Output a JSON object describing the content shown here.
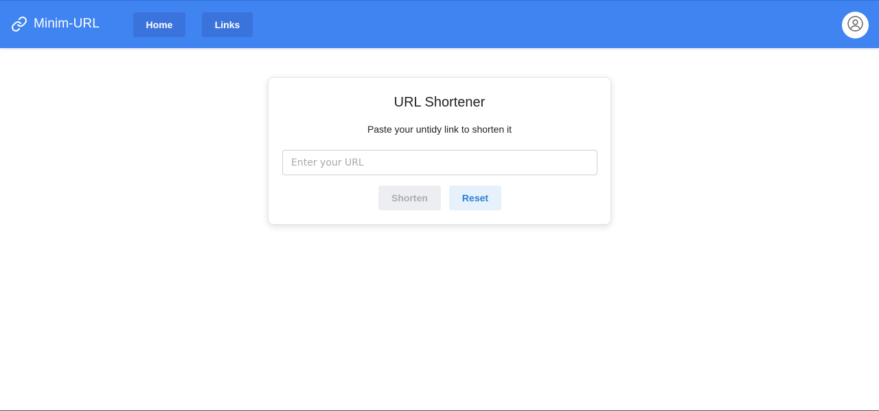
{
  "header": {
    "brand_icon": "link-icon",
    "brand_title": "Minim-URL",
    "nav": [
      {
        "label": "Home"
      },
      {
        "label": "Links"
      }
    ],
    "avatar_icon": "user-circle-icon"
  },
  "card": {
    "title": "URL Shortener",
    "subtitle": "Paste your untidy link to shorten it",
    "input": {
      "value": "",
      "placeholder": "Enter your URL"
    },
    "shorten_label": "Shorten",
    "reset_label": "Reset"
  },
  "colors": {
    "header_bg": "#3f84f1",
    "nav_button_bg": "#3a73dc",
    "reset_text": "#2a7fd4",
    "reset_bg": "#e7f1fb",
    "shorten_disabled_bg": "#eceef1",
    "shorten_disabled_text": "#a9adb3"
  }
}
